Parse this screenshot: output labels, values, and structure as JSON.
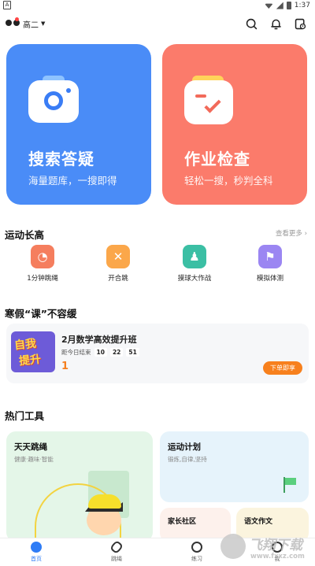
{
  "status_bar": {
    "carrier_icon": "A",
    "time": "1:37"
  },
  "header": {
    "grade": "高二"
  },
  "cards": {
    "search": {
      "title": "搜索答疑",
      "subtitle": "海量题库，一搜即得",
      "color": "#4a8cf7"
    },
    "check": {
      "title": "作业检查",
      "subtitle": "轻松一搜，秒判全科",
      "color": "#fb7b6b"
    }
  },
  "sports": {
    "title": "运动长高",
    "more": "查看更多",
    "items": [
      {
        "label": "1分钟跳绳",
        "icon": "jump-rope-icon"
      },
      {
        "label": "开合跳",
        "icon": "jumping-jack-icon"
      },
      {
        "label": "摸球大作战",
        "icon": "ball-game-icon"
      },
      {
        "label": "模拟体测",
        "icon": "flag-icon"
      }
    ]
  },
  "course": {
    "section_title": "寒假“课”不容缓",
    "cover_line1": "自我",
    "cover_line2": "提升",
    "title": "2月数学高效提升班",
    "countdown_label": "距今日结束",
    "hours": "10",
    "minutes": "22",
    "seconds": "51",
    "price": "1",
    "button": "下单即享"
  },
  "tools": {
    "title": "热门工具",
    "rope": {
      "name": "天天跳绳",
      "desc": "健康·趣味·智能"
    },
    "plan": {
      "name": "运动计划",
      "desc": "锻炼,自律,坚持"
    },
    "parent": {
      "name": "家长社区"
    },
    "essay": {
      "name": "语文作文"
    }
  },
  "watermark": {
    "text": "飞翔下载",
    "url": "www.fxxz.com"
  },
  "nav": {
    "items": [
      {
        "label": "首页",
        "icon": "home-icon"
      },
      {
        "label": "跳绳",
        "icon": "jump-rope-icon"
      },
      {
        "label": "练习",
        "icon": "compass-icon"
      },
      {
        "label": "我",
        "icon": "profile-icon"
      }
    ]
  }
}
